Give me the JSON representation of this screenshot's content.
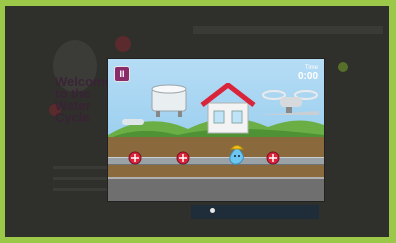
{
  "background": {
    "logo_text": [
      "Welcome",
      "to the",
      "Water",
      "Cycle"
    ]
  },
  "game": {
    "pause_label": "II",
    "timer_label": "Time",
    "timer_value": "0:00"
  },
  "colors": {
    "page_border": "#9cc84a",
    "pause_button": "#8a2b6a",
    "house_roof": "#d9243a",
    "valve": "#d9243a",
    "drop": "#6ec6f0",
    "hard_hat": "#f6c21c"
  },
  "icons": [
    "pause-icon",
    "water-tank-icon",
    "house-icon",
    "water-drop-character-icon",
    "valve-icon",
    "drone-icon"
  ]
}
